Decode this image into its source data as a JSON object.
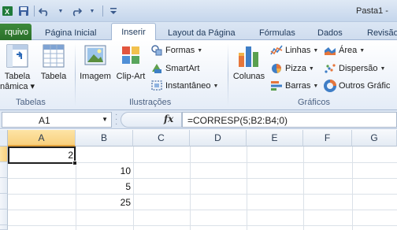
{
  "app": {
    "title": "Pasta1 -"
  },
  "qat": {
    "icons": [
      "excel-app-icon",
      "save-icon",
      "undo-icon",
      "redo-icon",
      "customize-qat-icon"
    ]
  },
  "tabs": {
    "file": "rquivo",
    "items": [
      "Página Inicial",
      "Inserir",
      "Layout da Página",
      "Fórmulas",
      "Dados",
      "Revisão"
    ],
    "active": "Inserir"
  },
  "ribbon": {
    "tabelas": {
      "group": "Tabelas",
      "pivot_line1": "Tabela",
      "pivot_line2": "nâmica ▾",
      "table": "Tabela"
    },
    "ilustracoes": {
      "group": "Ilustrações",
      "image": "Imagem",
      "clipart": "Clip-Art",
      "shapes": "Formas",
      "smartart": "SmartArt",
      "screenshot": "Instantâneo"
    },
    "graficos": {
      "group": "Gráficos",
      "columns": "Colunas",
      "lines": "Linhas",
      "pie": "Pizza",
      "bars": "Barras",
      "area": "Área",
      "scatter": "Dispersão",
      "other": "Outros Gráfic"
    }
  },
  "formula_bar": {
    "name_box": "A1",
    "fx": "fx",
    "formula": "=CORRESP(5;B2:B4;0)"
  },
  "grid": {
    "columns": [
      "A",
      "B",
      "C",
      "D",
      "E",
      "F",
      "G"
    ],
    "selected_column": "A",
    "cells": {
      "A1": "2",
      "B2": "10",
      "B3": "5",
      "B4": "25"
    }
  },
  "colors": {
    "file_tab": "#2a6f2a",
    "selection": "#f8d07e",
    "ribbon_bg": "#f1f5fb"
  }
}
